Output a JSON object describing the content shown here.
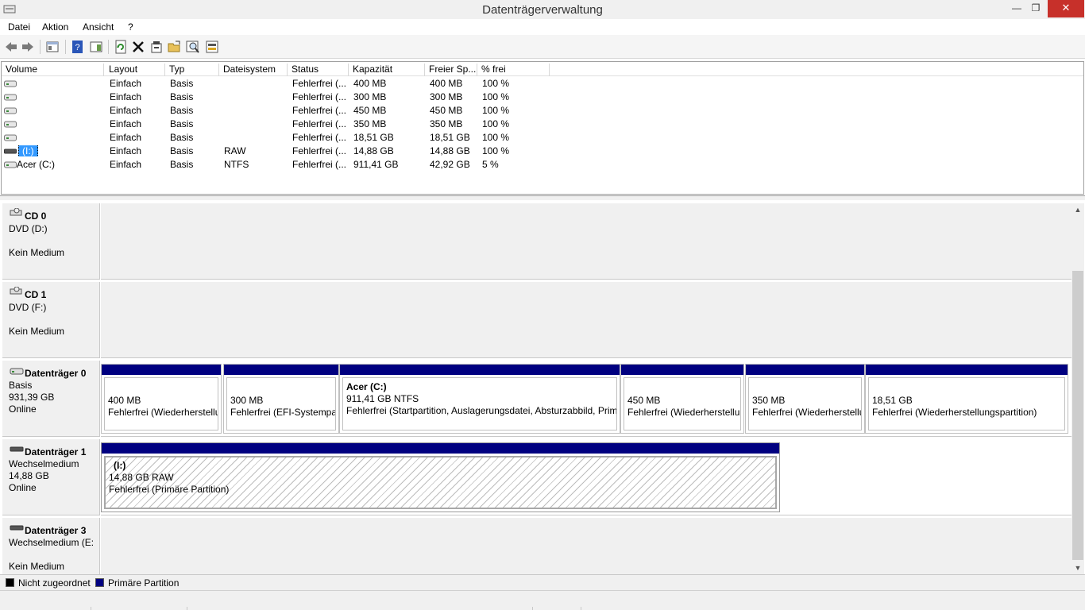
{
  "window": {
    "title": "Datenträgerverwaltung",
    "controls": {
      "minimize": "—",
      "maximize": "❐",
      "close": "✕"
    }
  },
  "menu": [
    "Datei",
    "Aktion",
    "Ansicht",
    "?"
  ],
  "toolbar_icons": [
    "back-icon",
    "forward-icon",
    "console-tree-icon",
    "help-icon",
    "show-hide-action-pane-icon",
    "refresh-icon",
    "delete-icon",
    "properties-icon",
    "open-icon",
    "find-icon",
    "rescan-disks-icon"
  ],
  "volumes": {
    "columns": [
      "Volume",
      "Layout",
      "Typ",
      "Dateisystem",
      "Status",
      "Kapazität",
      "Freier Sp...",
      "% frei"
    ],
    "rows": [
      {
        "volume": "",
        "layout": "Einfach",
        "typ": "Basis",
        "fs": "",
        "status": "Fehlerfrei (...",
        "cap": "400 MB",
        "free": "400 MB",
        "pct": "100 %"
      },
      {
        "volume": "",
        "layout": "Einfach",
        "typ": "Basis",
        "fs": "",
        "status": "Fehlerfrei (...",
        "cap": "300 MB",
        "free": "300 MB",
        "pct": "100 %"
      },
      {
        "volume": "",
        "layout": "Einfach",
        "typ": "Basis",
        "fs": "",
        "status": "Fehlerfrei (...",
        "cap": "450 MB",
        "free": "450 MB",
        "pct": "100 %"
      },
      {
        "volume": "",
        "layout": "Einfach",
        "typ": "Basis",
        "fs": "",
        "status": "Fehlerfrei (...",
        "cap": "350 MB",
        "free": "350 MB",
        "pct": "100 %"
      },
      {
        "volume": "",
        "layout": "Einfach",
        "typ": "Basis",
        "fs": "",
        "status": "Fehlerfrei (...",
        "cap": "18,51 GB",
        "free": "18,51 GB",
        "pct": "100 %"
      },
      {
        "volume": "(I:)",
        "layout": "Einfach",
        "typ": "Basis",
        "fs": "RAW",
        "status": "Fehlerfrei (...",
        "cap": "14,88 GB",
        "free": "14,88 GB",
        "pct": "100 %"
      },
      {
        "volume": "Acer (C:)",
        "layout": "Einfach",
        "typ": "Basis",
        "fs": "NTFS",
        "status": "Fehlerfrei (...",
        "cap": "911,41 GB",
        "free": "42,92 GB",
        "pct": "5 %"
      }
    ]
  },
  "disks": [
    {
      "name": "CD 0",
      "line2": "DVD (D:)",
      "line3": "",
      "line4": "Kein Medium"
    },
    {
      "name": "CD 1",
      "line2": "DVD (F:)",
      "line3": "",
      "line4": "Kein Medium"
    },
    {
      "name": "Datenträger 0",
      "line2": "Basis",
      "line3": "931,39 GB",
      "line4": "Online",
      "partitions": [
        {
          "title": "",
          "size": "400 MB",
          "status": "Fehlerfrei (Wiederherstellu"
        },
        {
          "title": "",
          "size": "300 MB",
          "status": "Fehlerfrei (EFI-Systempar"
        },
        {
          "title": "Acer  (C:)",
          "size": "911,41 GB NTFS",
          "status": "Fehlerfrei (Startpartition, Auslagerungsdatei, Absturzabbild, Prim"
        },
        {
          "title": "",
          "size": "450 MB",
          "status": "Fehlerfrei (Wiederherstellur"
        },
        {
          "title": "",
          "size": "350 MB",
          "status": "Fehlerfrei (Wiederherstellu"
        },
        {
          "title": "",
          "size": "18,51 GB",
          "status": "Fehlerfrei (Wiederherstellungspartition)"
        }
      ]
    },
    {
      "name": "Datenträger 1",
      "line2": "Wechselmedium",
      "line3": "14,88 GB",
      "line4": "Online",
      "partitions": [
        {
          "title": "(I:)",
          "size": "14,88 GB RAW",
          "status": "Fehlerfrei (Primäre Partition)"
        }
      ]
    },
    {
      "name": "Datenträger 3",
      "line2": "Wechselmedium (E:",
      "line3": "",
      "line4": "Kein Medium"
    }
  ],
  "legend": [
    {
      "label": "Nicht zugeordnet",
      "color": "#000000"
    },
    {
      "label": "Primäre Partition",
      "color": "#000080"
    }
  ],
  "colors": {
    "partition_bar": "#000080",
    "selection": "#3399ff",
    "close_button": "#c7302a"
  }
}
